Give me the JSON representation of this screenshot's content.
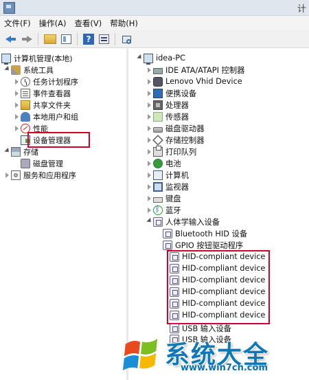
{
  "window": {
    "title": "计"
  },
  "menu": {
    "file": "文件(F)",
    "action": "操作(A)",
    "view": "查看(V)",
    "help": "帮助(H)"
  },
  "toolbar": {
    "icons": [
      "back-arrow-icon",
      "forward-arrow-icon",
      "up-folder-icon",
      "show-hide-tree-icon",
      "help-icon",
      "properties-icon",
      "scan-hardware-icon"
    ]
  },
  "tree": {
    "root": "计算机管理(本地)",
    "system_tools": "系统工具",
    "task_scheduler": "任务计划程序",
    "event_viewer": "事件查看器",
    "shared_folders": "共享文件夹",
    "local_users": "本地用户和组",
    "performance": "性能",
    "device_manager": "设备管理器",
    "storage": "存储",
    "disk_management": "磁盘管理",
    "services": "服务和应用程序"
  },
  "devices": {
    "root": "idea-PC",
    "items": [
      "IDE ATA/ATAPI 控制器",
      "Lenovo Vhid Device",
      "便携设备",
      "处理器",
      "传感器",
      "磁盘驱动器",
      "存储控制器",
      "打印队列",
      "电池",
      "计算机",
      "监视器",
      "键盘",
      "蓝牙"
    ],
    "hid_category": "人体学输入设备",
    "hid_children": [
      "Bluetooth HID 设备",
      "GPIO 按钮驱动程序",
      "HID-compliant device",
      "HID-compliant device",
      "HID-compliant device",
      "HID-compliant device",
      "HID-compliant device",
      "HID-compliant device",
      "USB 输入设备",
      "USB 输入设备"
    ]
  },
  "watermark": {
    "title": "系统大全",
    "url": "www.win7cn.com"
  },
  "colors": {
    "highlight_box": "#d4002a",
    "watermark_text": "#0f79b8"
  }
}
